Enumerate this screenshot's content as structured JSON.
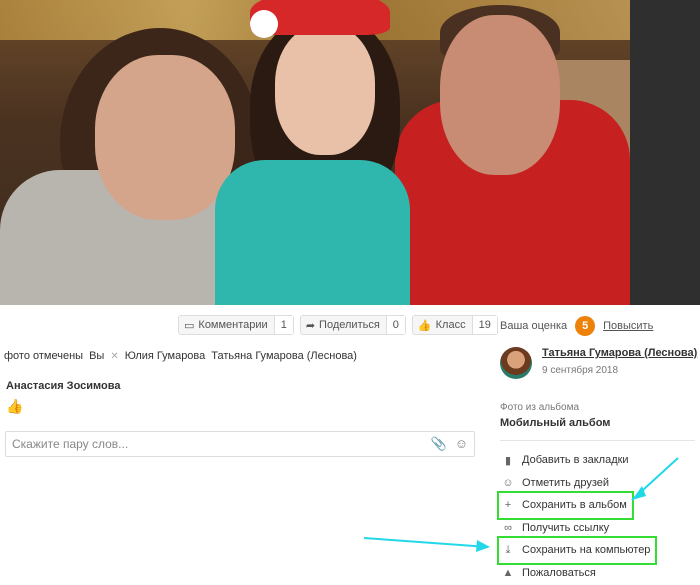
{
  "actions": {
    "comments": {
      "label": "Комментарии",
      "count": "1"
    },
    "share": {
      "label": "Поделиться",
      "count": "0"
    },
    "like": {
      "label": "Класс",
      "count": "19"
    }
  },
  "tags": {
    "prefix": "фото отмечены",
    "people": [
      "Вы",
      "Юлия Гумарова",
      "Татьяна Гумарова (Леснова)"
    ]
  },
  "comment": {
    "author": "Анастасия Зосимова",
    "reaction": "👍",
    "input_placeholder": "Скажите пару слов..."
  },
  "sidebar": {
    "rating_label": "Ваша оценка",
    "rating_value": "5",
    "raise_label": "Повысить",
    "author_name": "Татьяна Гумарова (Леснова)",
    "date": "9 сентября 2018",
    "album_label": "Фото из альбома",
    "album_name": "Мобильный альбом",
    "menu": [
      {
        "label": "Добавить в закладки",
        "icon": "bookmark-icon",
        "glyph": "▮",
        "highlight": false
      },
      {
        "label": "Отметить друзей",
        "icon": "tag-person-icon",
        "glyph": "☺",
        "highlight": false
      },
      {
        "label": "Сохранить в альбом",
        "icon": "plus-icon",
        "glyph": "+",
        "highlight": true
      },
      {
        "label": "Получить ссылку",
        "icon": "link-icon",
        "glyph": "∞",
        "highlight": false
      },
      {
        "label": "Сохранить на компьютер",
        "icon": "download-icon",
        "glyph": "⤓",
        "highlight": true
      },
      {
        "label": "Пожаловаться",
        "icon": "warning-icon",
        "glyph": "▲",
        "highlight": false
      }
    ]
  },
  "colors": {
    "accent": "#ee8208",
    "highlight": "#33dd33",
    "arrow": "#22d8e8"
  }
}
